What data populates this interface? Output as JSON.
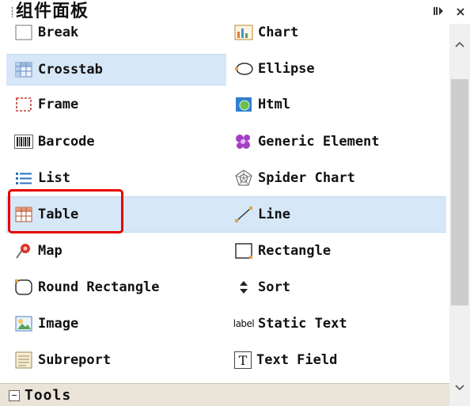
{
  "panel": {
    "title": "组件面板"
  },
  "header": {
    "pin_icon": "dock-pin-icon",
    "close_icon": "close-icon",
    "close_glyph": "×"
  },
  "palette": {
    "left": [
      {
        "label": "Break",
        "icon": "break-icon"
      },
      {
        "label": "Crosstab",
        "icon": "crosstab-icon",
        "selected": true
      },
      {
        "label": "Frame",
        "icon": "frame-icon"
      },
      {
        "label": "Barcode",
        "icon": "barcode-icon"
      },
      {
        "label": "List",
        "icon": "list-icon"
      },
      {
        "label": "Table",
        "icon": "table-icon",
        "selected": true
      },
      {
        "label": "Map",
        "icon": "map-pin-icon"
      },
      {
        "label": "Round Rectangle",
        "icon": "round-rectangle-icon"
      },
      {
        "label": "Image",
        "icon": "image-icon"
      },
      {
        "label": "Subreport",
        "icon": "subreport-icon"
      }
    ],
    "right": [
      {
        "label": "Chart",
        "icon": "chart-icon"
      },
      {
        "label": "Ellipse",
        "icon": "ellipse-icon"
      },
      {
        "label": "Html",
        "icon": "html-globe-icon"
      },
      {
        "label": "Generic Element",
        "icon": "generic-element-icon"
      },
      {
        "label": "Spider Chart",
        "icon": "spider-chart-icon"
      },
      {
        "label": "Line",
        "icon": "line-icon"
      },
      {
        "label": "Rectangle",
        "icon": "rectangle-icon"
      },
      {
        "label": "Sort",
        "icon": "sort-icon"
      },
      {
        "label": "Static Text",
        "icon": "static-text-icon",
        "icon_text": "label"
      },
      {
        "label": "Text Field",
        "icon": "text-field-icon",
        "icon_text": "T"
      }
    ]
  },
  "footer": {
    "label": "Tools",
    "icon": "collapse-minus-icon"
  },
  "colors": {
    "selection": "#d6e7f7",
    "highlight": "#e60000",
    "footer_bg": "#e9e3d8"
  }
}
